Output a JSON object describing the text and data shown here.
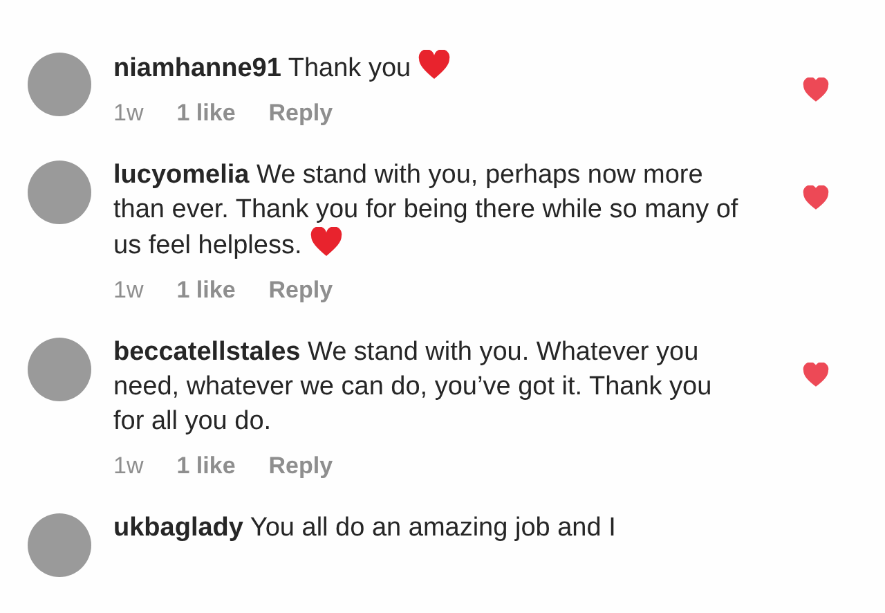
{
  "comments": [
    {
      "username": "niamhanne91",
      "text": "Thank you",
      "heart_emoji": true,
      "time": "1w",
      "likes": "1 like",
      "reply": "Reply",
      "liked": true
    },
    {
      "username": "lucyomelia",
      "text": "We stand with you, perhaps now more than ever. Thank you for being there while so many of us feel helpless.",
      "heart_emoji": true,
      "time": "1w",
      "likes": "1 like",
      "reply": "Reply",
      "liked": true
    },
    {
      "username": "beccatellstales",
      "text": "We stand with you. Whatever you need, whatever we can do, you’ve got it. Thank you for all you do.",
      "heart_emoji": false,
      "time": "1w",
      "likes": "1 like",
      "reply": "Reply",
      "liked": true
    },
    {
      "username": "ukbaglady",
      "text": "You all do an amazing job and I",
      "heart_emoji": false
    }
  ]
}
